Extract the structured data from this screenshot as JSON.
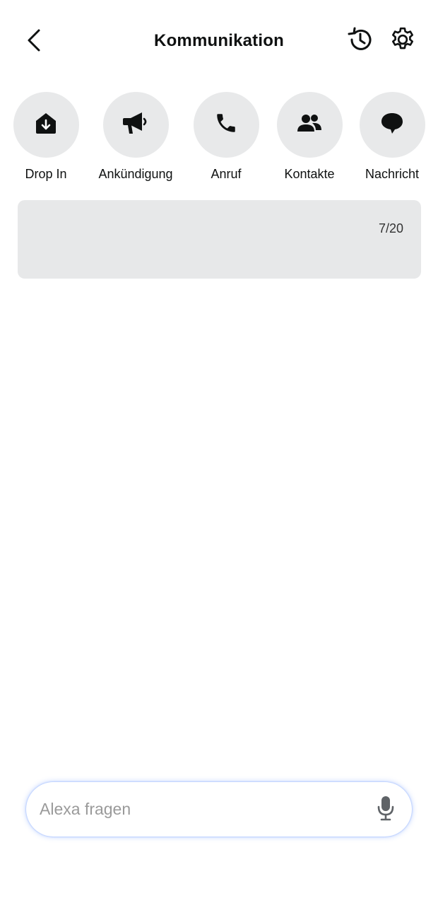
{
  "header": {
    "title": "Kommunikation",
    "back_icon": "chevron-left-icon",
    "history_icon": "history-icon",
    "settings_icon": "gear-icon"
  },
  "actions": [
    {
      "label": "Drop In",
      "icon": "drop-in-icon"
    },
    {
      "label": "Ankündigung",
      "icon": "megaphone-icon"
    },
    {
      "label": "Anruf",
      "icon": "phone-icon"
    },
    {
      "label": "Kontakte",
      "icon": "contacts-icon"
    },
    {
      "label": "Nachricht",
      "icon": "message-icon"
    }
  ],
  "message_card": {
    "sender": "",
    "preview": "",
    "count": "7/20"
  },
  "alexa_bar": {
    "placeholder": "Alexa fragen",
    "mic_icon": "microphone-icon"
  },
  "colors": {
    "background": "#ffffff",
    "action_circle": "#e8e9ea",
    "card_background": "#e7e8e9",
    "icon": "#0f1111",
    "alexa_glow": "#5a8cff"
  }
}
